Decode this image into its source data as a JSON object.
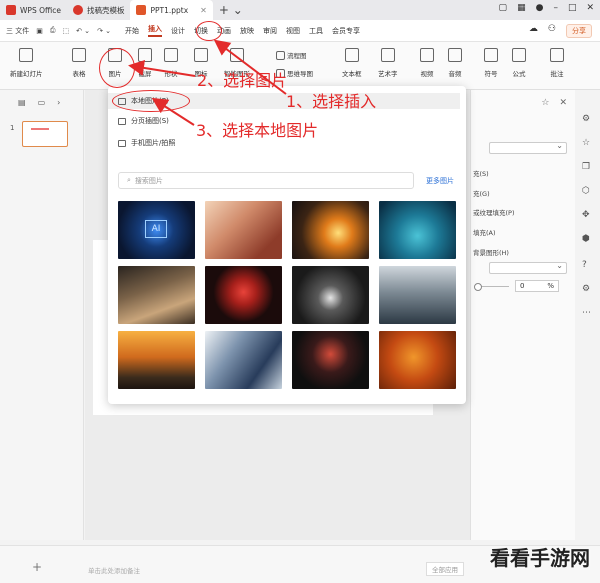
{
  "titlebar": {
    "tabs": [
      {
        "label": "WPS Office",
        "color": "#d9372c"
      },
      {
        "label": "找稿壳模板",
        "color": "#d9372c"
      },
      {
        "label": "PPT1.pptx",
        "color": "#e0562a"
      }
    ]
  },
  "menubar": {
    "file": "三 文件",
    "tabs": [
      "开始",
      "插入",
      "设计",
      "切换",
      "动画",
      "放映",
      "审阅",
      "视图",
      "工具",
      "会员专享"
    ],
    "active_tab": "插入",
    "share": "分享"
  },
  "ribbon": {
    "new_slide": "新建幻灯片",
    "table": "表格",
    "picture": "图片",
    "screenshot": "截屏",
    "shape": "形状",
    "icon": "图标",
    "smartart": "智能图形",
    "flowchart": "流程图",
    "mindmap": "思维导图",
    "textbox": "文本框",
    "wordart": "艺术字",
    "video": "视频",
    "audio": "音频",
    "symbol": "符号",
    "formula": "公式",
    "comment": "批注"
  },
  "dropdown": {
    "items": [
      "本地图片(P)",
      "分页插图(S)",
      "手机图片/拍照"
    ],
    "search_placeholder": "搜索图片",
    "more": "更多图片"
  },
  "rightpanel": {
    "options": [
      "充(S)",
      "充(G)",
      "或纹理填充(P)",
      "填充(A)",
      "背景图形(H)"
    ],
    "percent_value": "0",
    "percent_unit": "%"
  },
  "bottombar": {
    "note_placeholder": "单击此处添加备注",
    "apply_all": "全部应用"
  },
  "annotations": {
    "step1": "1、选择插入",
    "step2": "2、选择图片",
    "step3": "3、选择本地图片"
  },
  "watermark": "看看手游网",
  "colors": {
    "accent": "#c23a20",
    "annotation_red": "#e32b2b",
    "link": "#2a6fd6"
  }
}
